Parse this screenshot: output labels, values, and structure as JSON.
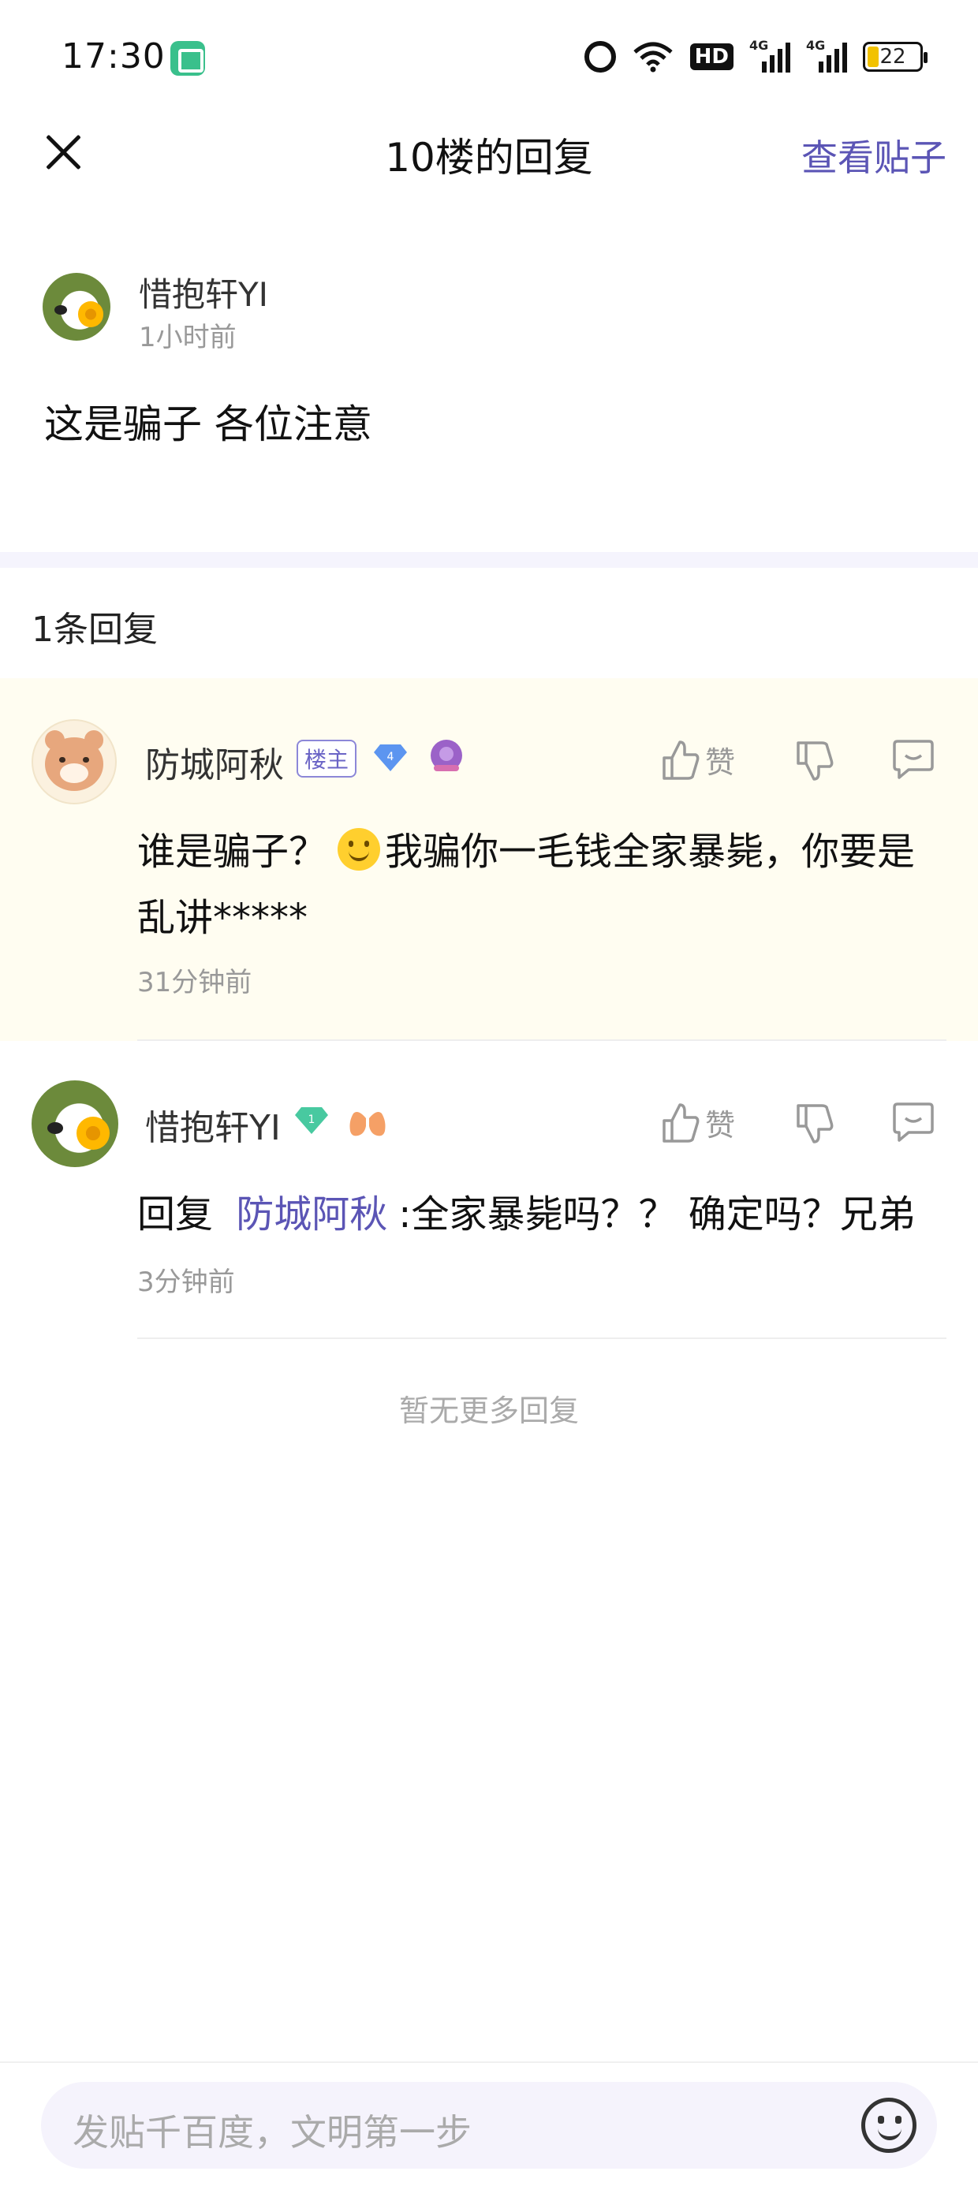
{
  "status_bar": {
    "time": "17:30",
    "network_1": "4G",
    "network_2": "4G",
    "hd": "HD",
    "battery": "22"
  },
  "nav": {
    "title": "10楼的回复",
    "view_post_label": "查看贴子"
  },
  "post": {
    "username": "惜抱轩YI",
    "time": "1小时前",
    "content": "这是骗子 各位注意"
  },
  "reply_count_label": "1条回复",
  "replies": [
    {
      "username": "防城阿秋",
      "host_badge": "楼主",
      "level": "4",
      "like_label": "赞",
      "content_part1": "谁是骗子？",
      "content_part2": "我骗你一毛钱全家暴毙，你要是乱讲*****",
      "time": "31分钟前"
    },
    {
      "username": "惜抱轩YI",
      "level": "1",
      "like_label": "赞",
      "reply_prefix": "回复",
      "mention": "防城阿秋",
      "content": ":全家暴毙吗？？ 确定吗？兄弟",
      "time": "3分钟前"
    }
  ],
  "no_more_label": "暂无更多回复",
  "input": {
    "placeholder": "发贴千百度，文明第一步"
  },
  "colors": {
    "accent": "#5b55b5",
    "highlight_bg": "#fffdf1",
    "section_band": "#f5f4fd"
  },
  "icons": [
    "close-icon",
    "thumbs-up-icon",
    "thumbs-down-icon",
    "comment-icon",
    "emoji-icon",
    "diamond-icon",
    "level-badge-icon",
    "lungs-icon",
    "alarm-icon",
    "wifi-icon",
    "signal-icon",
    "battery-icon"
  ]
}
